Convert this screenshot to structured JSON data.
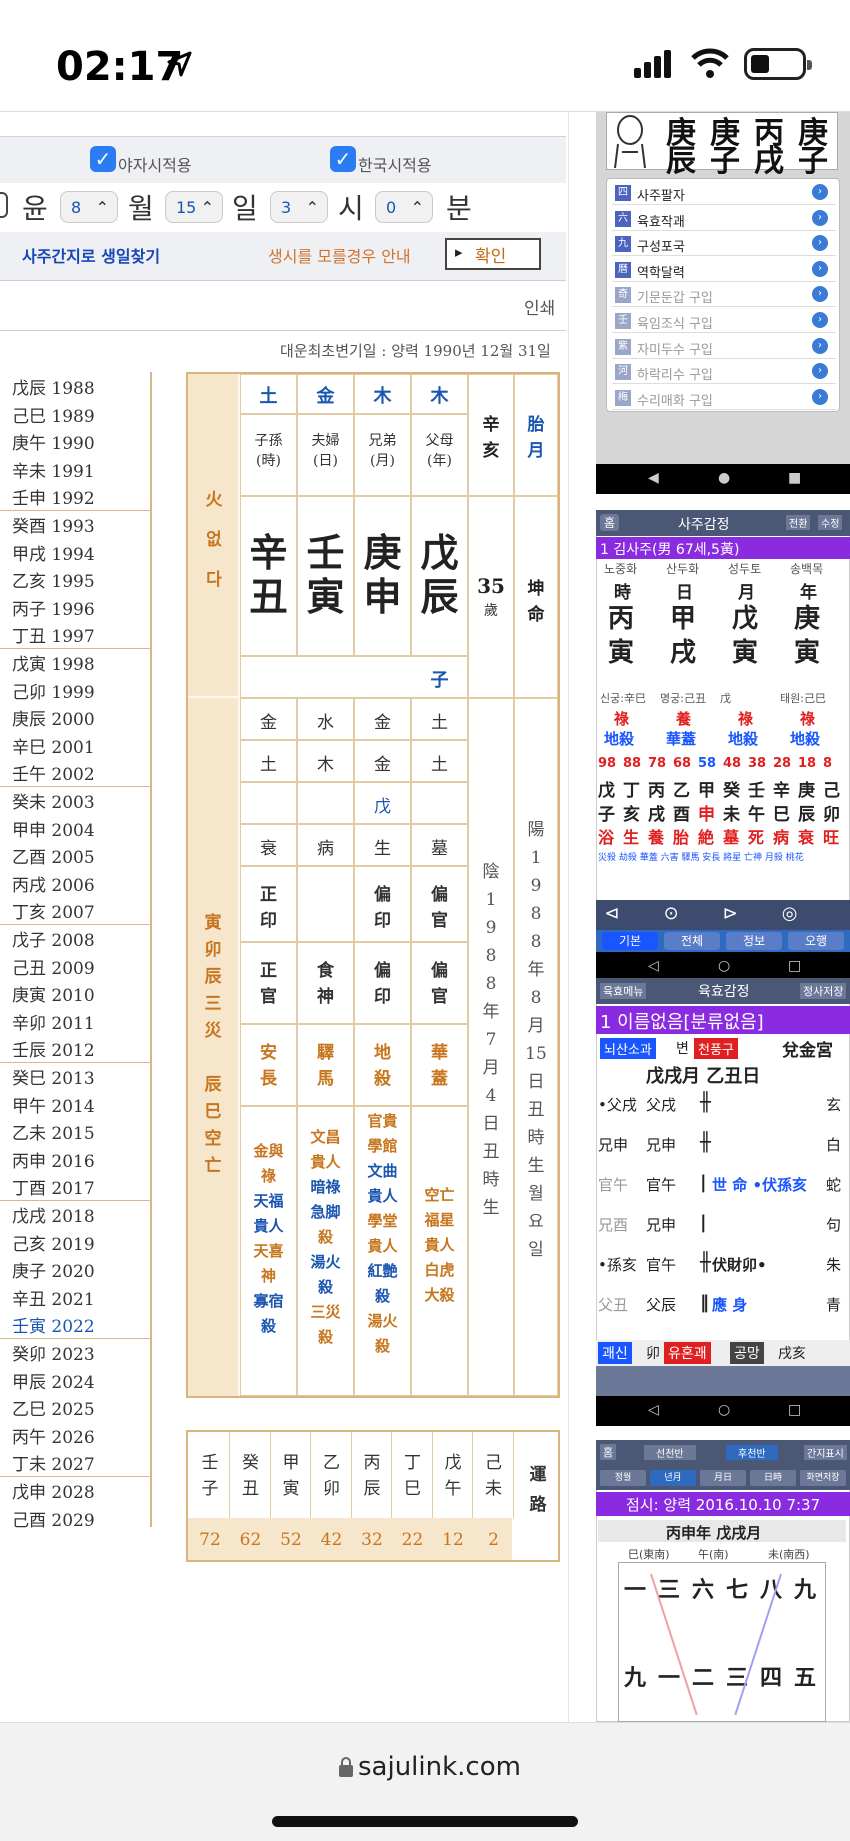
{
  "status": {
    "time": "02:17",
    "url": "sajulink.com"
  },
  "options": {
    "night": "야자시적용",
    "korea": "한국시적용"
  },
  "date": {
    "lead": "윤",
    "month": "8",
    "mlabel": "월",
    "day": "15",
    "dlabel": "일",
    "hour": "3",
    "hlabel": "시",
    "min": "0",
    "minlabel": "분"
  },
  "links": {
    "find": "사주간지로 생일찾기",
    "guide": "생시를 모를경우 안내",
    "ok": "확인",
    "print": "인쇄"
  },
  "firstday": "대운최초변기일 : 양력 1990년 12월 31일",
  "years": [
    "戊辰 1988",
    "己巳 1989",
    "庚午 1990",
    "辛未 1991",
    "壬申 1992",
    "癸酉 1993",
    "甲戌 1994",
    "乙亥 1995",
    "丙子 1996",
    "丁丑 1997",
    "戊寅 1998",
    "己卯 1999",
    "庚辰 2000",
    "辛巳 2001",
    "壬午 2002",
    "癸未 2003",
    "甲申 2004",
    "乙酉 2005",
    "丙戌 2006",
    "丁亥 2007",
    "戊子 2008",
    "己丑 2009",
    "庚寅 2010",
    "辛卯 2011",
    "壬辰 2012",
    "癸巳 2013",
    "甲午 2014",
    "乙未 2015",
    "丙申 2016",
    "丁酉 2017",
    "戊戌 2018",
    "己亥 2019",
    "庚子 2020",
    "辛丑 2021",
    "壬寅 2022",
    "癸卯 2023",
    "甲辰 2024",
    "乙巳 2025",
    "丙午 2026",
    "丁未 2027",
    "戊申 2028",
    "己酉 2029"
  ],
  "saju": {
    "fire": "火",
    "none": "없",
    "da": "다",
    "elements": [
      "土",
      "金",
      "木",
      "木"
    ],
    "roles": [
      [
        "子孫",
        "(時)"
      ],
      [
        "夫婦",
        "(日)"
      ],
      [
        "兄弟",
        "(月)"
      ],
      [
        "父母",
        "(年)"
      ]
    ],
    "stems": [
      "辛",
      "壬",
      "庚",
      "戊"
    ],
    "branches": [
      "丑",
      "寅",
      "申",
      "辰"
    ],
    "xinhai": [
      "辛",
      "亥"
    ],
    "taiyue": [
      "胎",
      "月"
    ],
    "age": "35",
    "agesuffix": "歲",
    "mingming": [
      "坤",
      "命"
    ],
    "zi": "子",
    "row1": [
      "金",
      "水",
      "金",
      "土"
    ],
    "row2": [
      "土",
      "木",
      "金",
      "土"
    ],
    "row3": [
      "",
      "",
      "戊",
      ""
    ],
    "row4": [
      "衰",
      "病",
      "生",
      "墓"
    ],
    "row5": [
      [
        "正",
        "印"
      ],
      [
        "",
        ""
      ],
      [
        "偏",
        "印"
      ],
      [
        "偏",
        "官"
      ]
    ],
    "row6": [
      [
        "正",
        "官"
      ],
      [
        "食",
        "神"
      ],
      [
        "偏",
        "印"
      ],
      [
        "偏",
        "官"
      ]
    ],
    "row7": [
      [
        "安",
        "長"
      ],
      [
        "驛",
        "馬"
      ],
      [
        "地",
        "殺"
      ],
      [
        "華",
        "蓋"
      ]
    ],
    "sinsal1": [
      "金與",
      "祿",
      "天福",
      "貴人",
      "天喜",
      "神",
      "寡宿",
      "殺"
    ],
    "sinsal2": [
      "文昌",
      "貴人",
      "暗祿",
      "急脚",
      "殺",
      "湯火",
      "殺",
      "三災",
      "殺"
    ],
    "sinsal3": [
      "官貴",
      "學館",
      "文曲",
      "貴人",
      "學堂",
      "貴人",
      "紅艶",
      "殺",
      "湯火",
      "殺"
    ],
    "sinsal4": [
      "空亡",
      "福星",
      "貴人",
      "白虎",
      "大殺"
    ],
    "samjae": [
      "寅",
      "卯",
      "辰",
      "三",
      "災",
      "",
      "辰",
      "巳",
      "空",
      "亡"
    ],
    "yin": [
      "陰",
      "1",
      "9",
      "8",
      "8",
      "年",
      "7",
      "月",
      "4",
      "日",
      "丑",
      "時",
      "生"
    ],
    "yang": [
      "陽",
      "1",
      "9",
      "8",
      "8",
      "年",
      "8",
      "月",
      "15",
      "日",
      "丑",
      "時",
      "生",
      "월",
      "요",
      "일"
    ],
    "daeun_stems": [
      "壬",
      "癸",
      "甲",
      "乙",
      "丙",
      "丁",
      "戊",
      "己"
    ],
    "daeun_branches": [
      "子",
      "丑",
      "寅",
      "卯",
      "辰",
      "巳",
      "午",
      "未"
    ],
    "daeun_ages": [
      "72",
      "62",
      "52",
      "42",
      "32",
      "22",
      "12",
      "2"
    ],
    "unro": [
      "運",
      "路"
    ]
  },
  "right": {
    "top_pillars": [
      "庚",
      "庚",
      "丙",
      "庚",
      "辰",
      "子",
      "戌",
      "子"
    ],
    "menu": [
      [
        "四",
        "사주팔자"
      ],
      [
        "六",
        "육효작괘"
      ],
      [
        "九",
        "구성포국"
      ],
      [
        "曆",
        "역학달력"
      ],
      [
        "奇",
        "기문둔갑 구입"
      ],
      [
        "壬",
        "육임조식 구입"
      ],
      [
        "紫",
        "자미두수 구입"
      ],
      [
        "河",
        "하락리수 구입"
      ],
      [
        "梅",
        "수리매화 구입"
      ]
    ],
    "s2": {
      "home": "홈",
      "title": "사주감정",
      "b1": "전환",
      "b2": "수정",
      "person": "1 김사주(男 67세,5黃)",
      "cols": [
        "노중화",
        "산두화",
        "성두토",
        "송백목"
      ],
      "heads": [
        "時",
        "日",
        "月",
        "年"
      ],
      "stems": [
        "丙",
        "甲",
        "戊",
        "庚"
      ],
      "branches": [
        "寅",
        "戌",
        "寅",
        "寅"
      ],
      "info": [
        "신궁:辛巳",
        "명궁:己丑",
        "戊",
        "태원:己巳"
      ],
      "sal1": [
        "祿",
        "養",
        "祿",
        "祿"
      ],
      "sal2": [
        "地殺",
        "華蓋",
        "地殺",
        "地殺"
      ],
      "nums": [
        "98",
        "88",
        "78",
        "68",
        "58",
        "48",
        "38",
        "28",
        "18",
        "8"
      ],
      "ds": [
        "戊",
        "丁",
        "丙",
        "乙",
        "甲",
        "癸",
        "壬",
        "辛",
        "庚",
        "己"
      ],
      "db": [
        "子",
        "亥",
        "戌",
        "酉",
        "申",
        "未",
        "午",
        "巳",
        "辰",
        "卯"
      ],
      "st": [
        "浴",
        "生",
        "養",
        "胎",
        "絶",
        "墓",
        "死",
        "病",
        "衰",
        "旺"
      ],
      "tiny": "災殺 劫殺 華蓋 六害 驛馬 安長 將星 亡神 月殺 桃花",
      "tabs": [
        "기본",
        "전체",
        "정보",
        "오행"
      ]
    },
    "s3": {
      "left": "육효메뉴",
      "title": "육효감정",
      "right": "정사저장",
      "person": "1 이름없음[분류없음]",
      "tag1": "뇌산소과",
      "tag2": "변",
      "tag3": "천풍구",
      "gong": "兌金宮",
      "date": "戊戌月  乙丑日",
      "lines": [
        [
          "•父戌",
          "父戌",
          "",
          "玄"
        ],
        [
          "兄申",
          "兄申",
          "",
          "白"
        ],
        [
          "官午",
          "官午",
          "世 命 •伏孫亥",
          "蛇"
        ],
        [
          "兄酉",
          "兄申",
          "",
          "句"
        ],
        [
          "•孫亥",
          "官午",
          "伏財卯•",
          "朱"
        ],
        [
          "父丑",
          "父辰",
          "應 身",
          "青"
        ]
      ],
      "bottom": [
        "괘신",
        "卯",
        "유혼괘",
        "공망",
        "戌亥"
      ]
    },
    "s4": {
      "home": "홈",
      "b1": "선천반",
      "b2": "후천반",
      "b3": "간지표시",
      "tabs": [
        "정월",
        "년月",
        "月日",
        "日時",
        "화면저장"
      ],
      "title": "점시: 양력 2016.10.10 7:37",
      "sub": "丙申年 戊戌月",
      "dirs": [
        "巳(東南)",
        "午(南)",
        "未(南西)"
      ],
      "row1": [
        "一",
        "三",
        "六",
        "七",
        "八",
        "九"
      ],
      "row2": [
        "九",
        "一",
        "二",
        "三",
        "四",
        "五"
      ]
    }
  },
  "colors": {
    "tan": "#f5e6cc",
    "blue": "#1a56b0",
    "orange": "#c8761e",
    "purple": "#8a2be2",
    "red": "#e02020"
  }
}
